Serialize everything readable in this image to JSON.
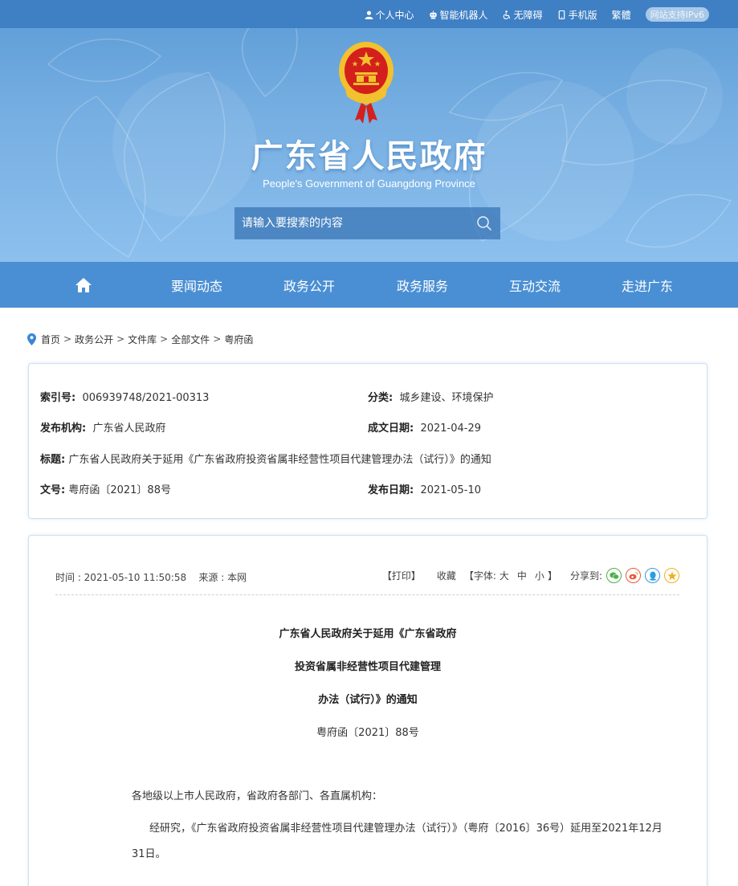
{
  "topbar": {
    "items": [
      {
        "label": "个人中心",
        "icon": "person-icon"
      },
      {
        "label": "智能机器人",
        "icon": "robot-icon"
      },
      {
        "label": "无障碍",
        "icon": "accessibility-icon"
      },
      {
        "label": "手机版",
        "icon": "mobile-icon"
      },
      {
        "label": "繁體"
      }
    ],
    "ipv6_badge": "网站支持IPv6"
  },
  "header": {
    "title": "广东省人民政府",
    "subtitle": "People's Government of Guangdong Province",
    "search_placeholder": "请输入要搜索的内容"
  },
  "nav": {
    "home_icon": "home-icon",
    "items": [
      "要闻动态",
      "政务公开",
      "政务服务",
      "互动交流",
      "走进广东"
    ]
  },
  "breadcrumb": {
    "items": [
      "首页",
      "政务公开",
      "文件库",
      "全部文件",
      "粤府函"
    ],
    "separator": ">"
  },
  "info": {
    "index_label": "索引号:",
    "index_value": "006939748/2021-00313",
    "category_label": "分类:",
    "category_value": "城乡建设、环境保护",
    "publisher_label": "发布机构:",
    "publisher_value": "广东省人民政府",
    "created_label": "成文日期:",
    "created_value": "2021-04-29",
    "title_label": "标题:",
    "title_value": "广东省人民政府关于延用《广东省政府投资省属非经营性项目代建管理办法（试行）》的通知",
    "docno_label": "文号:",
    "docno_value": "粤府函〔2021〕88号",
    "published_label": "发布日期:",
    "published_value": "2021-05-10"
  },
  "article": {
    "time": "时间 : 2021-05-10 11:50:58",
    "source": "来源 : 本网",
    "print": "【打印】",
    "favorite": "收藏",
    "font_prefix": "【字体:",
    "font_large": "大",
    "font_medium": "中",
    "font_small": "小",
    "font_suffix": "】",
    "share_label": "分享到:",
    "share_icons": [
      "wechat-icon",
      "weibo-icon",
      "qq-icon",
      "qzone-icon"
    ],
    "title_lines": [
      "广东省人民政府关于延用《广东省政府",
      "投资省属非经营性项目代建管理",
      "办法（试行）》的通知"
    ],
    "doc_number": "粤府函〔2021〕88号",
    "salutation": "各地级以上市人民政府，省政府各部门、各直属机构：",
    "paragraph_line1": "经研究，《广东省政府投资省属非经营性项目代建管理办法（试行）》（粤府〔2016〕36号）延用至2021年12月",
    "paragraph_line2": "31日。"
  },
  "colors": {
    "topbar": "#3f7fc4",
    "nav": "#4a8fd3",
    "hero_top": "#5b9bd6",
    "panel_border": "#cfe0f0",
    "emblem_red": "#d4201c",
    "emblem_gold": "#f2c12e"
  }
}
